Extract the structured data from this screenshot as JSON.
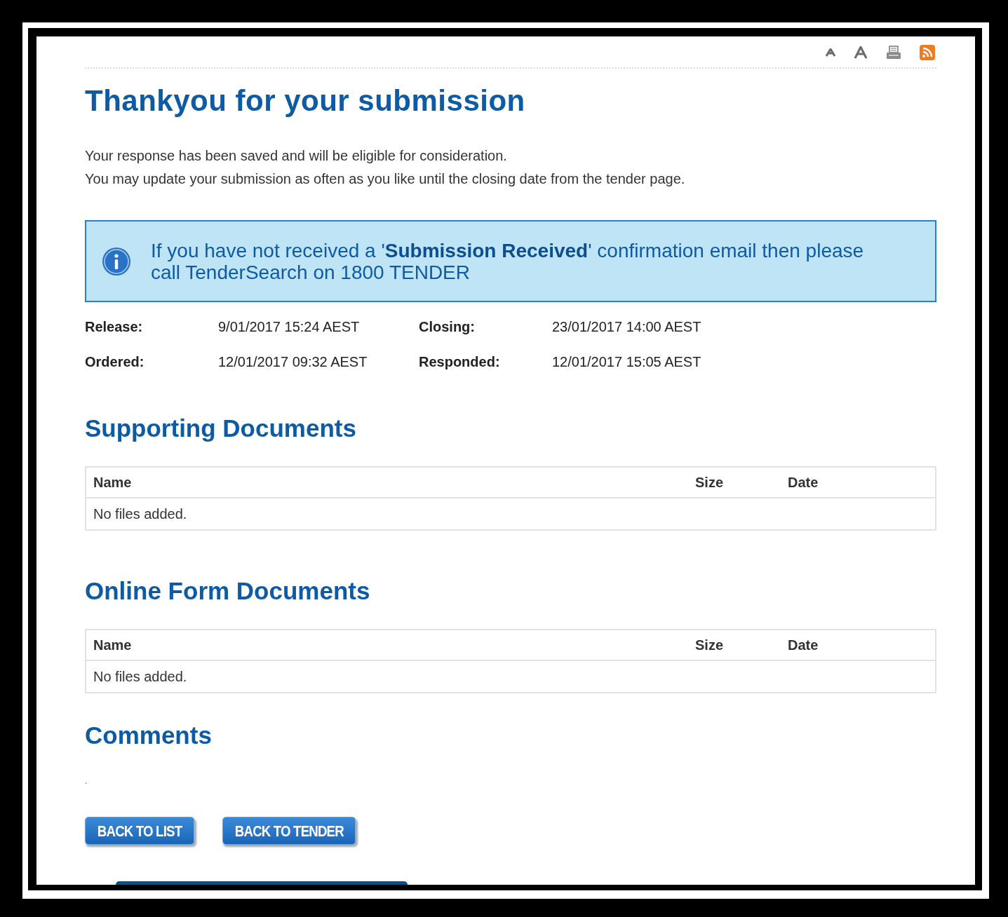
{
  "toolbar": {
    "icons": [
      {
        "kind": "font-small"
      },
      {
        "kind": "font-large"
      },
      {
        "kind": "print"
      },
      {
        "kind": "rss"
      }
    ]
  },
  "title": "Thankyou for your submission",
  "intro": [
    "Your response has been saved and will be eligible for consideration.",
    "You may update your submission as often as you like until the closing date from the tender page."
  ],
  "notice": "If you have not received a '**Submission Received**' confirmation email then please call TenderSearch on 1800 TENDER",
  "details": [
    {
      "label": "Release:",
      "value": "9/01/2017 15:24 AEST"
    },
    {
      "label": "Closing:",
      "value": "23/01/2017 14:00 AEST"
    },
    {
      "label": "Ordered:",
      "value": "12/01/2017 09:32 AEST"
    },
    {
      "label": "Responded:",
      "value": "12/01/2017 15:05 AEST"
    }
  ],
  "sections": [
    {
      "title": "Supporting Documents",
      "columns": [
        "Name",
        "Size",
        "Date"
      ],
      "empty": "No files added."
    },
    {
      "title": "Online Form Documents",
      "columns": [
        "Name",
        "Size",
        "Date"
      ],
      "empty": "No files added."
    }
  ],
  "comments": {
    "title": "Comments",
    "text": "."
  },
  "buttons": [
    "BACK TO LIST",
    "BACK TO TENDER"
  ]
}
